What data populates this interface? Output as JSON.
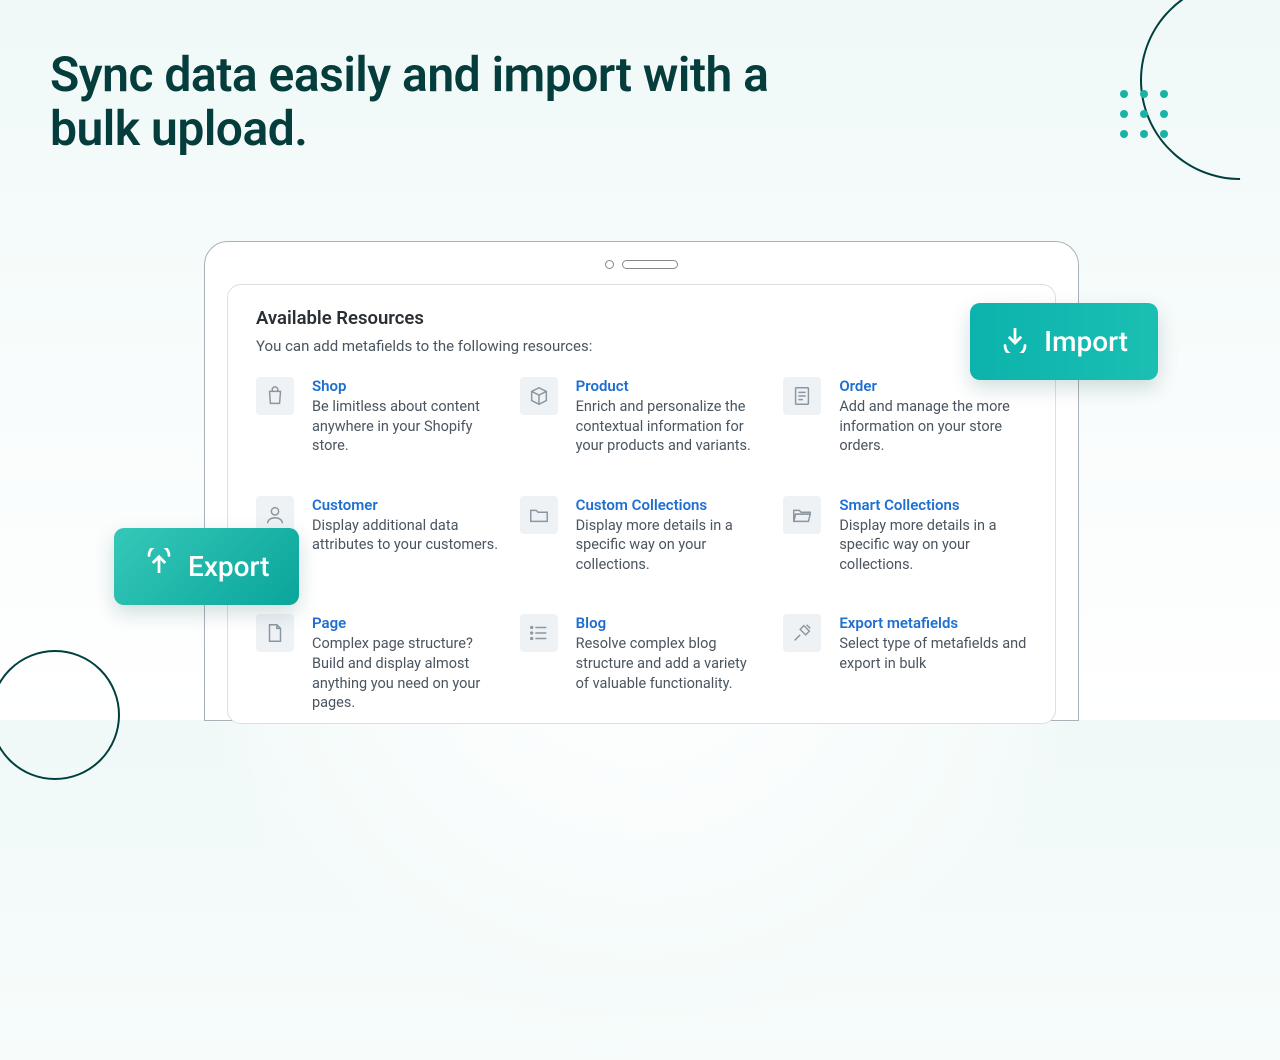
{
  "headline": "Sync data easily and import with a bulk upload.",
  "import_label": "Import",
  "export_label": "Export",
  "panel": {
    "title": "Available Resources",
    "subtitle": "You can add metafields to the following resources:",
    "items": [
      {
        "title": "Shop",
        "desc": "Be limitless about content anywhere in your Shopify store."
      },
      {
        "title": "Product",
        "desc": "Enrich and personalize the contextual information for your products and variants."
      },
      {
        "title": "Order",
        "desc": "Add and manage the more information on your store orders."
      },
      {
        "title": "Customer",
        "desc": "Display additional data attributes to your customers."
      },
      {
        "title": "Custom Collections",
        "desc": "Display more details in a specific way on your collections."
      },
      {
        "title": "Smart Collections",
        "desc": "Display more details in a specific way on your collections."
      },
      {
        "title": "Page",
        "desc": "Complex page structure? Build and display almost anything you need on your pages."
      },
      {
        "title": "Blog",
        "desc": "Resolve complex blog structure and add a variety of valuable functionality."
      },
      {
        "title": "Export metafields",
        "desc": "Select type of metafields and export in bulk"
      }
    ]
  }
}
